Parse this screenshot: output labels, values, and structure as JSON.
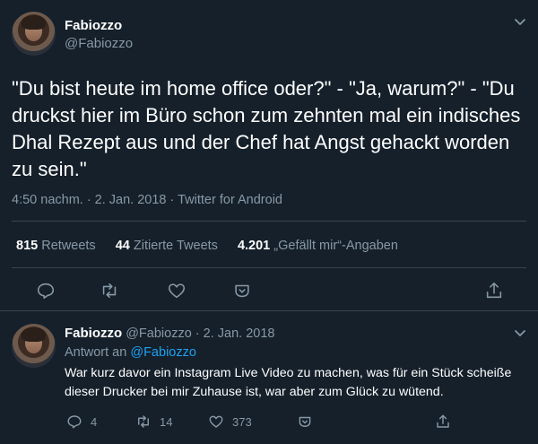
{
  "tweet": {
    "author_name": "Fabiozzo",
    "author_handle": "@Fabiozzo",
    "text": "\"Du bist heute im home office oder?\" - \"Ja, warum?\" - \"Du druckst hier im Büro schon zum zehnten mal ein indisches Dhal Rezept aus und der Chef hat Angst gehackt worden zu sein.\"",
    "meta": "4:50 nachm. · 2. Jan. 2018 · Twitter for Android",
    "stats": {
      "retweets_count": "815",
      "retweets_label": "Retweets",
      "quotes_count": "44",
      "quotes_label": "Zitierte Tweets",
      "likes_count": "4.201",
      "likes_label": "„Gefällt mir“-Angaben"
    },
    "icons": [
      "chevron-down-icon",
      "reply-icon",
      "retweet-icon",
      "like-icon",
      "caret-down-icon",
      "share-icon"
    ]
  },
  "reply": {
    "author_name": "Fabiozzo",
    "author_handle": "@Fabiozzo",
    "date": "· 2. Jan. 2018",
    "replying_prefix": "Antwort an",
    "replying_handle": "@Fabiozzo",
    "text": "War kurz davor ein Instagram Live Video zu machen, was für ein Stück scheiße dieser Drucker bei mir Zuhause ist, war aber zum Glück zu wütend.",
    "reply_count": "4",
    "retweet_count": "14",
    "like_count": "373"
  },
  "colors": {
    "background": "#15202b",
    "text": "#ffffff",
    "muted": "#8899a6",
    "accent": "#1da1f2",
    "divider": "#38444d"
  }
}
